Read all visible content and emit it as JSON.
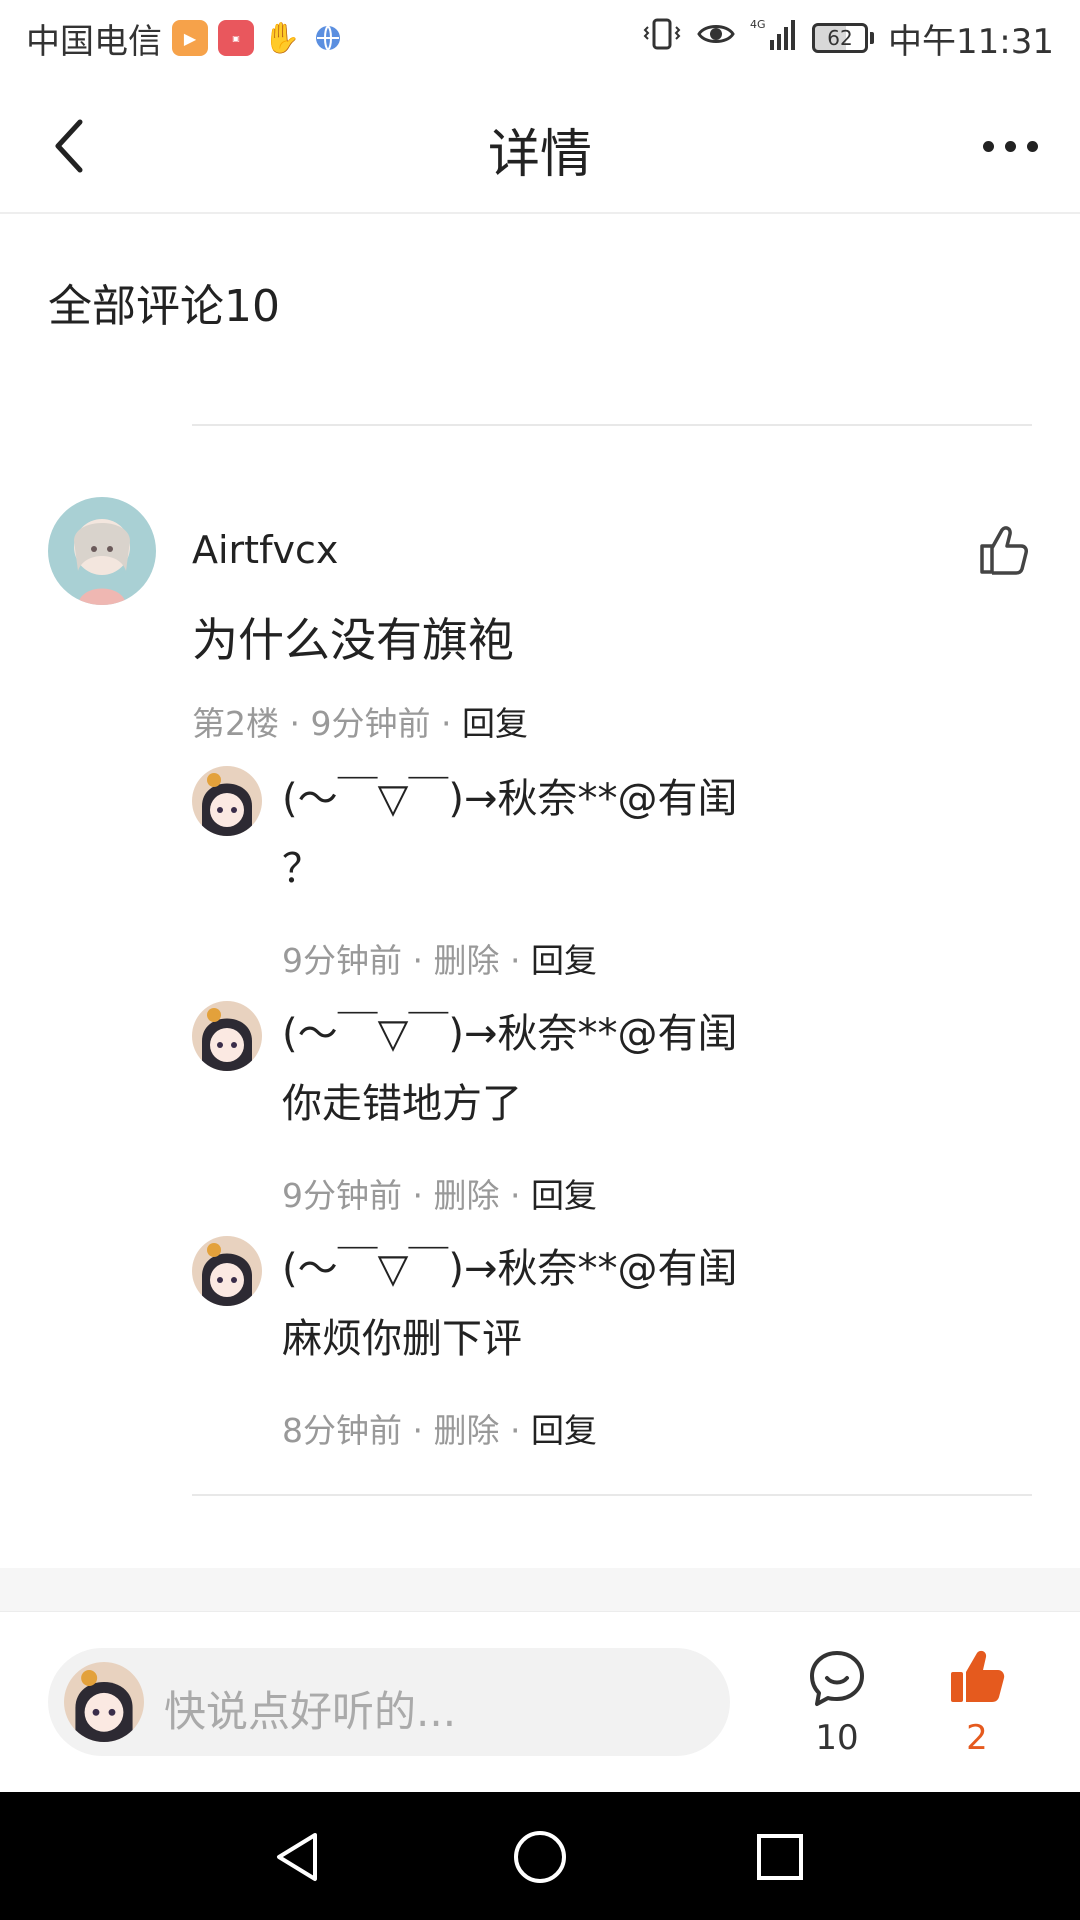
{
  "status_bar": {
    "carrier": "中国电信",
    "network": "4G",
    "battery": "62",
    "time": "中午11:31"
  },
  "header": {
    "title": "详情"
  },
  "comments_section": {
    "title": "全部评论10"
  },
  "main_comment": {
    "author": "Airtfvcx",
    "text": "为什么没有旗袍",
    "floor": "第2楼",
    "time": "9分钟前",
    "reply_label": "回复"
  },
  "replies": [
    {
      "author": "(～￣▽￣)→秋奈**@有闺",
      "text": "？",
      "time": "9分钟前",
      "delete_label": "删除",
      "reply_label": "回复"
    },
    {
      "author": "(～￣▽￣)→秋奈**@有闺",
      "text": "你走错地方了",
      "time": "9分钟前",
      "delete_label": "删除",
      "reply_label": "回复"
    },
    {
      "author": "(～￣▽￣)→秋奈**@有闺",
      "text": "麻烦你删下评",
      "time": "8分钟前",
      "delete_label": "删除",
      "reply_label": "回复"
    }
  ],
  "bottom_bar": {
    "placeholder": "快说点好听的...",
    "comment_count": "10",
    "like_count": "2"
  },
  "colors": {
    "accent_like": "#e55a1e",
    "meta_gray": "#999999"
  }
}
